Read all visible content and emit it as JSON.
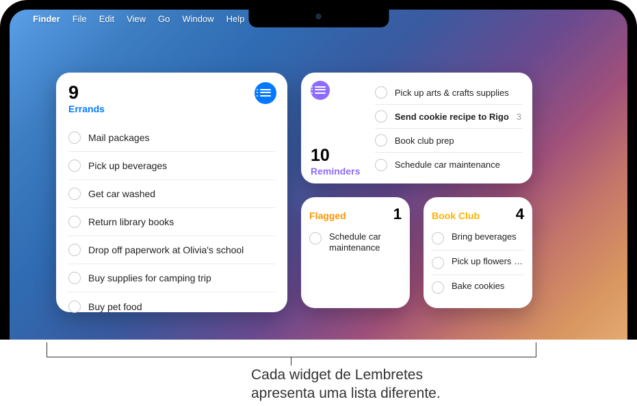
{
  "menubar": {
    "app": "Finder",
    "items": [
      "File",
      "Edit",
      "View",
      "Go",
      "Window",
      "Help"
    ]
  },
  "widgets": {
    "errands": {
      "icon": "list-icon",
      "accent": "#0479ff",
      "count": "9",
      "title": "Errands",
      "items": [
        "Mail packages",
        "Pick up beverages",
        "Get car washed",
        "Return library books",
        "Drop off paperwork at Olivia's school",
        "Buy supplies for camping trip",
        "Buy pet food"
      ]
    },
    "reminders": {
      "icon": "list-icon",
      "accent": "#8e6cff",
      "count": "10",
      "title": "Reminders",
      "items": [
        {
          "label": "Pick up arts & crafts supplies",
          "bold": false,
          "trailing": ""
        },
        {
          "label": "Send cookie recipe to Rigo",
          "bold": true,
          "trailing": "3"
        },
        {
          "label": "Book club prep",
          "bold": false,
          "trailing": ""
        },
        {
          "label": "Schedule car maintenance",
          "bold": false,
          "trailing": ""
        }
      ]
    },
    "flagged": {
      "accent": "#ff9500",
      "title": "Flagged",
      "count": "1",
      "items": [
        "Schedule car maintenance"
      ]
    },
    "bookclub": {
      "accent": "#ffb300",
      "title": "Book Club",
      "count": "4",
      "items": [
        "Bring beverages",
        "Pick up flowers f…",
        "Bake cookies"
      ]
    }
  },
  "callout": {
    "line1": "Cada widget de Lembretes",
    "line2": "apresenta uma lista diferente."
  }
}
